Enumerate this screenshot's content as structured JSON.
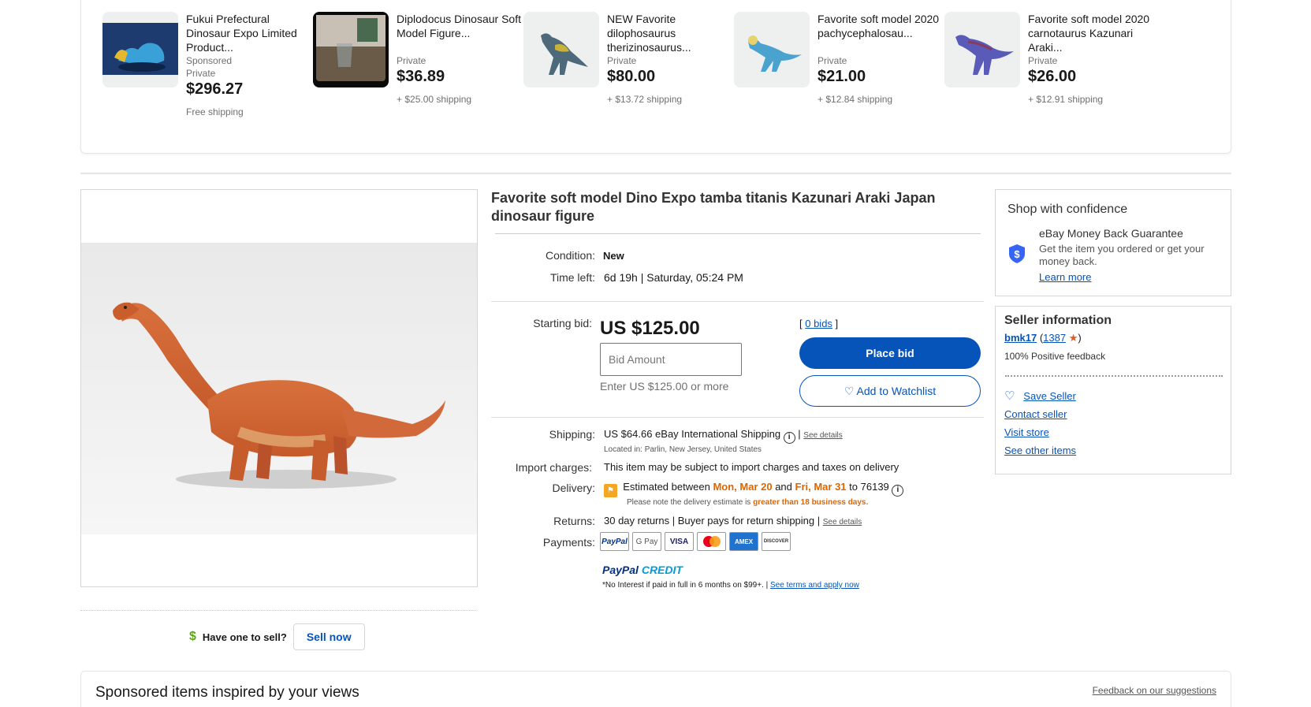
{
  "carousel": {
    "items": [
      {
        "title": "Fukui Prefectural Dinosaur Expo Limited Product...",
        "sponsored": "Sponsored",
        "seller_type": "Private",
        "price": "$296.27",
        "shipping": "Free shipping",
        "image": "blue-dinosaur-figure-image"
      },
      {
        "title": "Diplodocus Dinosaur Soft Model Figure...",
        "sponsored": "",
        "seller_type": "Private",
        "price": "$36.89",
        "shipping": "+ $25.00 shipping",
        "image": "diplodocus-figure-image"
      },
      {
        "title": "NEW Favorite dilophosaurus therizinosaurus...",
        "sponsored": "",
        "seller_type": "Private",
        "price": "$80.00",
        "shipping": "+ $13.72 shipping",
        "image": "therizinosaurus-figure-image"
      },
      {
        "title": "Favorite soft model 2020 pachycephalosau...",
        "sponsored": "",
        "seller_type": "Private",
        "price": "$21.00",
        "shipping": "+ $12.84 shipping",
        "image": "pachycephalosaurus-figure-image"
      },
      {
        "title": "Favorite soft model 2020 carnotaurus Kazunari Araki...",
        "sponsored": "",
        "seller_type": "Private",
        "price": "$26.00",
        "shipping": "+ $12.91 shipping",
        "image": "carnotaurus-figure-image"
      }
    ]
  },
  "listing": {
    "title": "Favorite soft model Dino Expo tamba titanis Kazunari Araki Japan dinosaur figure",
    "condition_label": "Condition:",
    "condition": "New",
    "time_left_label": "Time left:",
    "time_left": "6d 19h",
    "end_time": "Saturday, 05:24 PM",
    "starting_bid_label": "Starting bid:",
    "starting_bid": "US $125.00",
    "bid_placeholder": "Bid Amount",
    "bid_hint": "Enter US $125.00 or more",
    "bids_count": "0 bids",
    "place_bid": "Place bid",
    "watchlist": "Add to Watchlist",
    "shipping_label": "Shipping:",
    "shipping": "US $64.66 eBay International Shipping",
    "see_details": "See details",
    "location": "Located in: Parlin, New Jersey, United States",
    "import_label": "Import charges:",
    "import_text": "This item may be subject to import charges and taxes on delivery",
    "delivery_label": "Delivery:",
    "delivery_prefix": "Estimated between",
    "delivery_start": "Mon, Mar 20",
    "delivery_and": "and",
    "delivery_end": "Fri, Mar 31",
    "delivery_zip": "to 76139",
    "delivery_note_prefix": "Please note the delivery estimate is",
    "delivery_note_bold": "greater than 18 business days.",
    "returns_label": "Returns:",
    "returns": "30 day returns | Buyer pays for return shipping |",
    "returns_see": "See details",
    "payments_label": "Payments:",
    "payment_methods": [
      "PayPal",
      "G Pay",
      "VISA",
      "Mastercard",
      "AMEX",
      "DISCOVER"
    ],
    "paypal_credit_a": "PayPal",
    "paypal_credit_b": "CREDIT",
    "credit_note": "*No Interest if paid in full in 6 months on $99+. |",
    "credit_link": "See terms and apply now"
  },
  "sell": {
    "prompt": "Have one to sell?",
    "button": "Sell now"
  },
  "confidence": {
    "heading": "Shop with confidence",
    "mbg_title": "eBay Money Back Guarantee",
    "mbg_desc": "Get the item you ordered or get your money back.",
    "learn_more": "Learn more"
  },
  "seller": {
    "heading": "Seller information",
    "username": "bmk17",
    "feedback_score": "1387",
    "positive": "100% Positive feedback",
    "save": "Save Seller",
    "contact": "Contact seller",
    "store": "Visit store",
    "other": "See other items"
  },
  "sponsored": {
    "heading": "Sponsored items inspired by your views",
    "feedback": "Feedback on our suggestions"
  },
  "colors": {
    "link": "#0654ba",
    "accent_orange": "#dd6600",
    "price_text": "#191919"
  }
}
